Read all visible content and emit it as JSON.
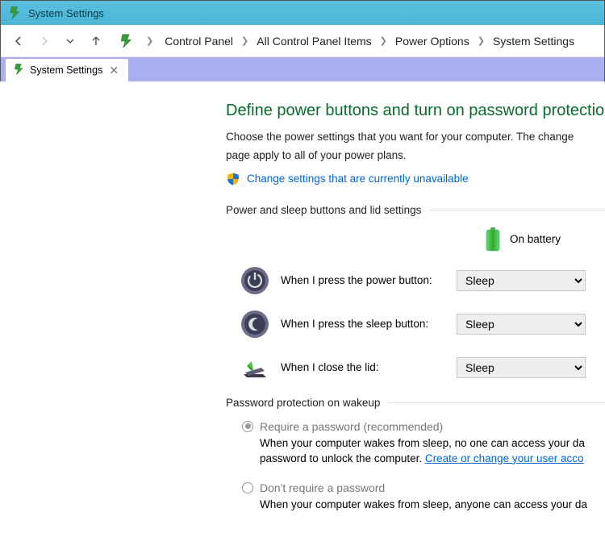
{
  "titlebar": {
    "title": "System Settings"
  },
  "nav": {
    "back": "←",
    "forward": "→",
    "down": "⌄",
    "up": "↑"
  },
  "breadcrumbs": [
    "Control Panel",
    "All Control Panel Items",
    "Power Options",
    "System Settings"
  ],
  "tab": {
    "label": "System Settings"
  },
  "heading": "Define power buttons and turn on password protection",
  "subtext1": "Choose the power settings that you want for your computer. The change",
  "subtext2": "page apply to all of your power plans.",
  "change_link": "Change settings that are currently unavailable",
  "group1_label": "Power and sleep buttons and lid settings",
  "battery_label": "On battery",
  "rows": {
    "power": {
      "label": "When I press the power button:",
      "value": "Sleep"
    },
    "sleep": {
      "label": "When I press the sleep button:",
      "value": "Sleep"
    },
    "lid": {
      "label": "When I close the lid:",
      "value": "Sleep"
    }
  },
  "group2_label": "Password protection on wakeup",
  "pw": {
    "require_label": "Require a password (recommended)",
    "require_desc1": "When your computer wakes from sleep, no one can access your da",
    "require_desc2a": "password to unlock the computer. ",
    "require_link": "Create or change your user acco",
    "dont_label": "Don't require a password",
    "dont_desc": "When your computer wakes from sleep, anyone can access your da"
  }
}
